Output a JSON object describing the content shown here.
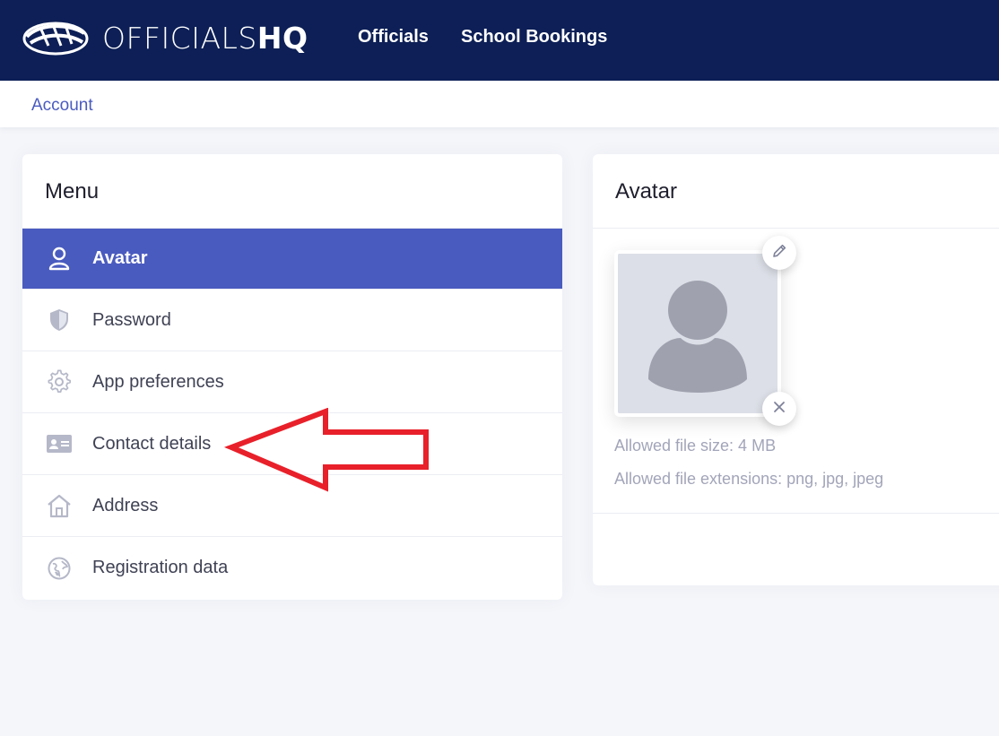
{
  "header": {
    "brand_light": "OFFICIALS",
    "brand_bold": "HQ",
    "nav": [
      {
        "label": "Officials"
      },
      {
        "label": "School Bookings"
      }
    ]
  },
  "breadcrumb": {
    "account_label": "Account"
  },
  "menu": {
    "title": "Menu",
    "items": [
      {
        "label": "Avatar",
        "icon": "user-icon",
        "active": true
      },
      {
        "label": "Password",
        "icon": "shield-icon",
        "active": false
      },
      {
        "label": "App preferences",
        "icon": "gear-icon",
        "active": false
      },
      {
        "label": "Contact details",
        "icon": "id-card-icon",
        "active": false
      },
      {
        "label": "Address",
        "icon": "home-icon",
        "active": false
      },
      {
        "label": "Registration data",
        "icon": "globe-icon",
        "active": false
      }
    ]
  },
  "avatar_panel": {
    "title": "Avatar",
    "file_size_hint": "Allowed file size: 4 MB",
    "extensions_hint": "Allowed file extensions: png, jpg, jpeg",
    "edit_icon": "pencil-icon",
    "remove_icon": "close-icon"
  },
  "colors": {
    "header_bg": "#0d1f56",
    "accent": "#4a5bbf",
    "annotation_arrow": "#e8202a"
  }
}
